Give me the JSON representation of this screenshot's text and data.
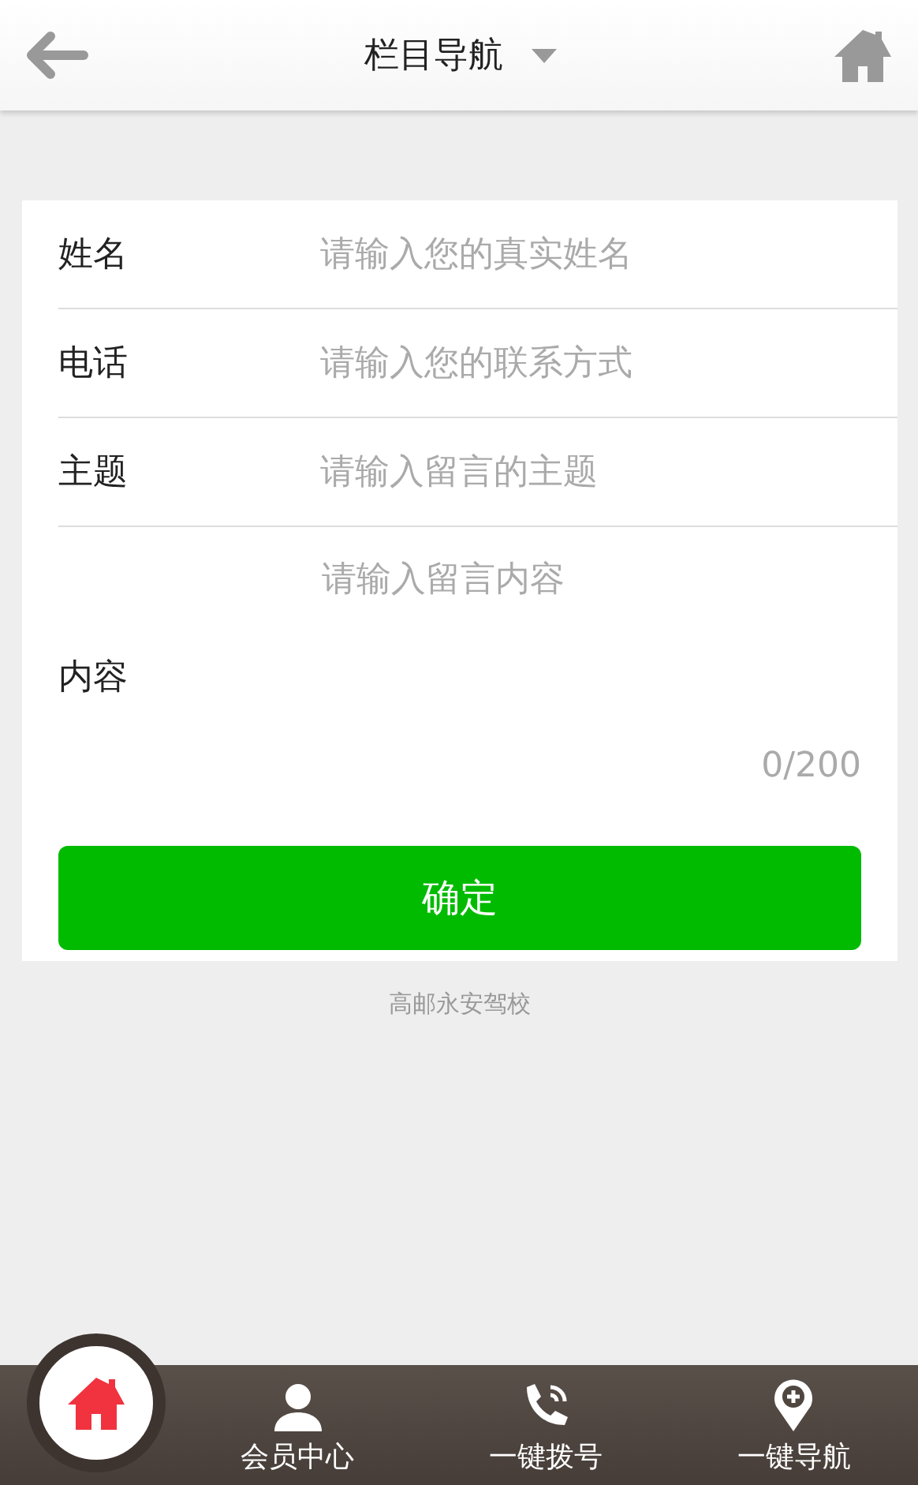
{
  "header": {
    "title": "栏目导航"
  },
  "form": {
    "fields": [
      {
        "label": "姓名",
        "placeholder": "请输入您的真实姓名"
      },
      {
        "label": "电话",
        "placeholder": "请输入您的联系方式"
      },
      {
        "label": "主题",
        "placeholder": "请输入留言的主题"
      }
    ],
    "message": {
      "label": "内容",
      "placeholder": "请输入留言内容",
      "counter": "0/200"
    },
    "submit": "确定"
  },
  "footer_text": "高邮永安驾校",
  "bottom_bar": {
    "items": [
      {
        "kind": "home"
      },
      {
        "kind": "user",
        "label": "会员中心"
      },
      {
        "kind": "phone",
        "label": "一键拨号"
      },
      {
        "kind": "pin",
        "label": "一键导航"
      }
    ]
  }
}
